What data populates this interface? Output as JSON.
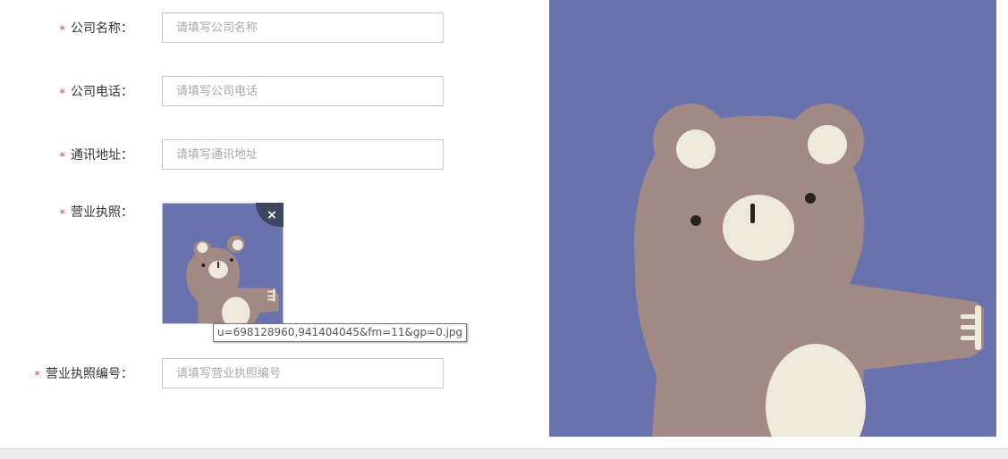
{
  "form": {
    "fields": [
      {
        "label": "公司名称：",
        "placeholder": "请填写公司名称"
      },
      {
        "label": "公司电话：",
        "placeholder": "请填写公司电话"
      },
      {
        "label": "通讯地址：",
        "placeholder": "请填写通讯地址"
      },
      {
        "label": "营业执照："
      },
      {
        "label": "营业执照编号：",
        "placeholder": "请填写营业执照编号"
      }
    ],
    "required_mark": "*"
  },
  "upload": {
    "filename_tooltip": "u=698128960,941404045&fm=11&gp=0.jpg",
    "remove_icon": "×"
  },
  "colors": {
    "required": "#e4393c",
    "image_background": "#6a72ad",
    "bear_body": "#a18a85",
    "bear_cream": "#efe9dc"
  }
}
